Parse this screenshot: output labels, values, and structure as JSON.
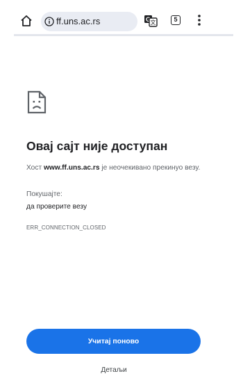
{
  "toolbar": {
    "url": "ff.uns.ac.rs",
    "tab_count": "5",
    "home_icon": "home-icon",
    "site_info_icon": "info-icon",
    "translate_icon": "translate-icon",
    "menu_icon": "more-vert-icon",
    "load_progress": 0.0
  },
  "error": {
    "icon": "sad-page-icon",
    "title": "Овај сајт није доступан",
    "host_prefix": "Хост ",
    "host": "www.ff.uns.ac.rs",
    "host_suffix": " је неочекивано прекинуо везу.",
    "try_label": "Покушајте:",
    "suggestion": "да проверите везу",
    "code": "ERR_CONNECTION_CLOSED"
  },
  "actions": {
    "reload": "Учитај поново",
    "details": "Детаљи"
  },
  "colors": {
    "accent": "#1a73e8",
    "omnibox_bg": "#e9ecf3",
    "text_primary": "#202124",
    "text_secondary": "#5f6368"
  }
}
